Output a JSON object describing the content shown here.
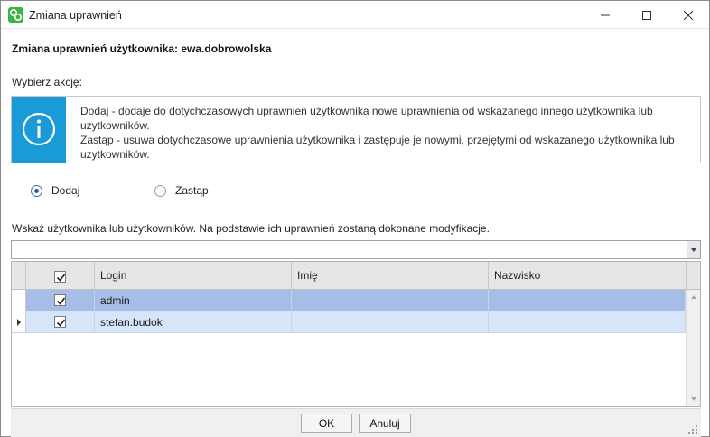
{
  "window": {
    "title": "Zmiana uprawnień",
    "icon": "chain-link-icon",
    "controls": [
      "minimize-icon",
      "maximize-icon",
      "close-icon"
    ]
  },
  "heading": "Zmiana uprawnień użytkownika: ewa.dobrowolska",
  "choose_action_label": "Wybierz akcję:",
  "info": {
    "icon": "info-icon",
    "line1": "Dodaj - dodaje do dotychczasowych uprawnień użytkownika nowe uprawnienia od wskazanego innego użytkownika lub użytkowników.",
    "line2": "Zastąp - usuwa dotychczasowe uprawnienia użytkownika i zastępuje je nowymi, przejętymi od wskazanego użytkownika lub użytkowników."
  },
  "actions": {
    "add_label": "Dodaj",
    "replace_label": "Zastąp",
    "selected": "Dodaj"
  },
  "hint": "Wskaż użytkownika lub użytkowników. Na podstawie ich uprawnień zostaną dokonane modyfikacje.",
  "search": {
    "value": ""
  },
  "grid": {
    "columns": {
      "login": "Login",
      "first_name": "Imię",
      "last_name": "Nazwisko"
    },
    "header_checked": true,
    "rows": [
      {
        "checked": true,
        "login": "admin",
        "first_name": "",
        "last_name": ""
      },
      {
        "checked": true,
        "login": "stefan.budok",
        "first_name": "",
        "last_name": ""
      }
    ]
  },
  "buttons": {
    "ok": "OK",
    "cancel": "Anuluj"
  },
  "colors": {
    "accent": "#1a9ad6",
    "selected_row": "#a6bde8",
    "row": "#d6e6f8",
    "app_icon": "#3bb54a"
  }
}
